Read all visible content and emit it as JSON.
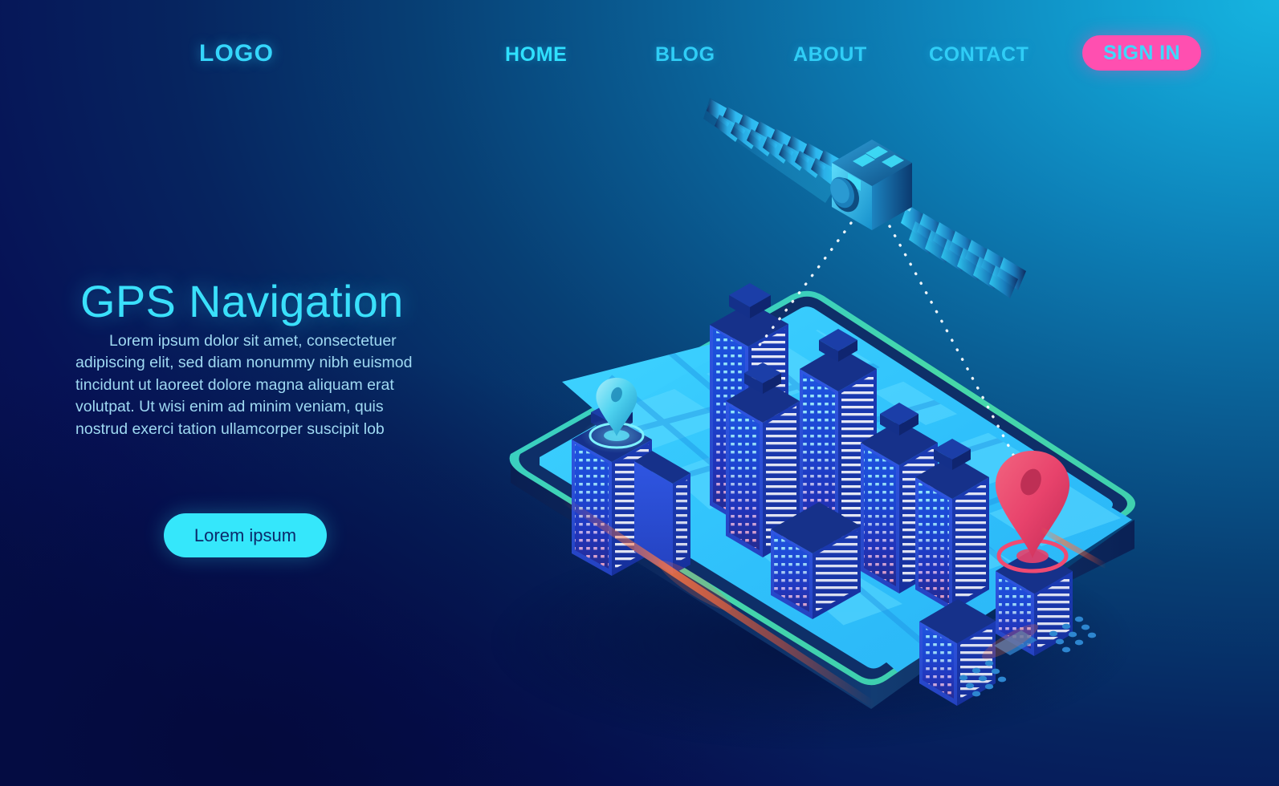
{
  "page": {
    "title": "GPS Navigation",
    "bg_gradient_from": "#16b4e0",
    "bg_gradient_to": "#061256"
  },
  "nav": {
    "logo": "LOGO",
    "links": [
      {
        "label": "HOME",
        "active": true
      },
      {
        "label": "BLOG",
        "active": false
      },
      {
        "label": "ABOUT",
        "active": false
      },
      {
        "label": "CONTACT",
        "active": false
      }
    ],
    "signin_label": "SIGN IN",
    "signin_bg": "#ff4fb0",
    "signin_text_color": "#3fd8fb",
    "link_color": "#2fcdf6"
  },
  "hero": {
    "heading": "GPS Navigation",
    "heading_color": "#3ae0fb",
    "body": "Lorem ipsum dolor sit amet, consectetuer adipiscing elit, sed diam nonummy nibh euismod tincidunt ut laoreet dolore magna aliquam erat volutpat. Ut wisi enim ad minim veniam, quis nostrud exerci tation ullamcorper suscipit lob",
    "body_color": "#9fd9f2",
    "cta_label": "Lorem ipsum",
    "cta_bg": "#35e7fb",
    "cta_text_color": "#0b2a6b"
  },
  "illustration": {
    "name": "isometric-smartphone-city-map-with-satellite",
    "satellite": {
      "body_color": "#25c7f5",
      "panel_color": "#2ec6f0",
      "dish_color": "#1a87c4"
    },
    "signal_lines": {
      "color": "#ffffff",
      "count": 2,
      "style": "dotted"
    },
    "phone": {
      "screen_color": "#36c6fb",
      "body_color": "#0d2a5e",
      "rim_color": "#3fcfae",
      "glow_color": "#ff6a3d"
    },
    "pins": [
      {
        "id": "origin-pin",
        "color": "#49d4ef",
        "label": "origin"
      },
      {
        "id": "destination-pin",
        "color": "#e8436c",
        "label": "destination"
      }
    ],
    "buildings": {
      "body_color": "#2a4fd8",
      "roof_color": "#14307f",
      "window_top_color": "#36f0f8",
      "window_bottom_color": "#f2447e",
      "count": 11
    },
    "map": {
      "ground_color": "#36c6fb",
      "block_color": "#5ad8ff",
      "road_color": "#1f8fe0"
    }
  }
}
